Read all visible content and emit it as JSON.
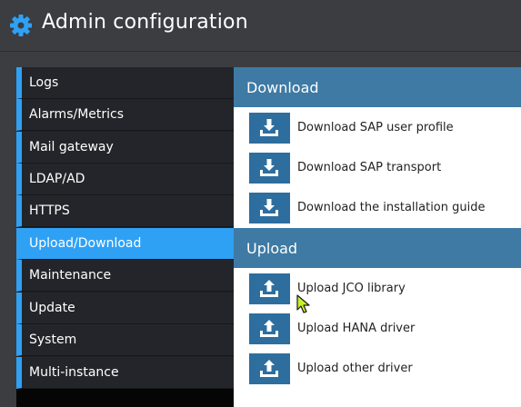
{
  "header": {
    "title": "Admin configuration",
    "icon": "gear-icon"
  },
  "sidebar": {
    "active_index": 5,
    "items": [
      {
        "label": "Logs"
      },
      {
        "label": "Alarms/Metrics"
      },
      {
        "label": "Mail gateway"
      },
      {
        "label": "LDAP/AD"
      },
      {
        "label": "HTTPS"
      },
      {
        "label": "Upload/Download"
      },
      {
        "label": "Maintenance"
      },
      {
        "label": "Update"
      },
      {
        "label": "System"
      },
      {
        "label": "Multi-instance"
      }
    ]
  },
  "download": {
    "title": "Download",
    "actions": [
      {
        "label": "Download SAP user profile"
      },
      {
        "label": "Download SAP transport"
      },
      {
        "label": "Download the installation guide"
      }
    ]
  },
  "upload": {
    "title": "Upload",
    "actions": [
      {
        "label": "Upload JCO library"
      },
      {
        "label": "Upload HANA driver"
      },
      {
        "label": "Upload other driver"
      }
    ]
  },
  "colors": {
    "accent": "#2fa1f5",
    "section_header": "#3e7aa4",
    "action_button": "#2e6e9e",
    "sidebar_bg": "#23252a"
  }
}
